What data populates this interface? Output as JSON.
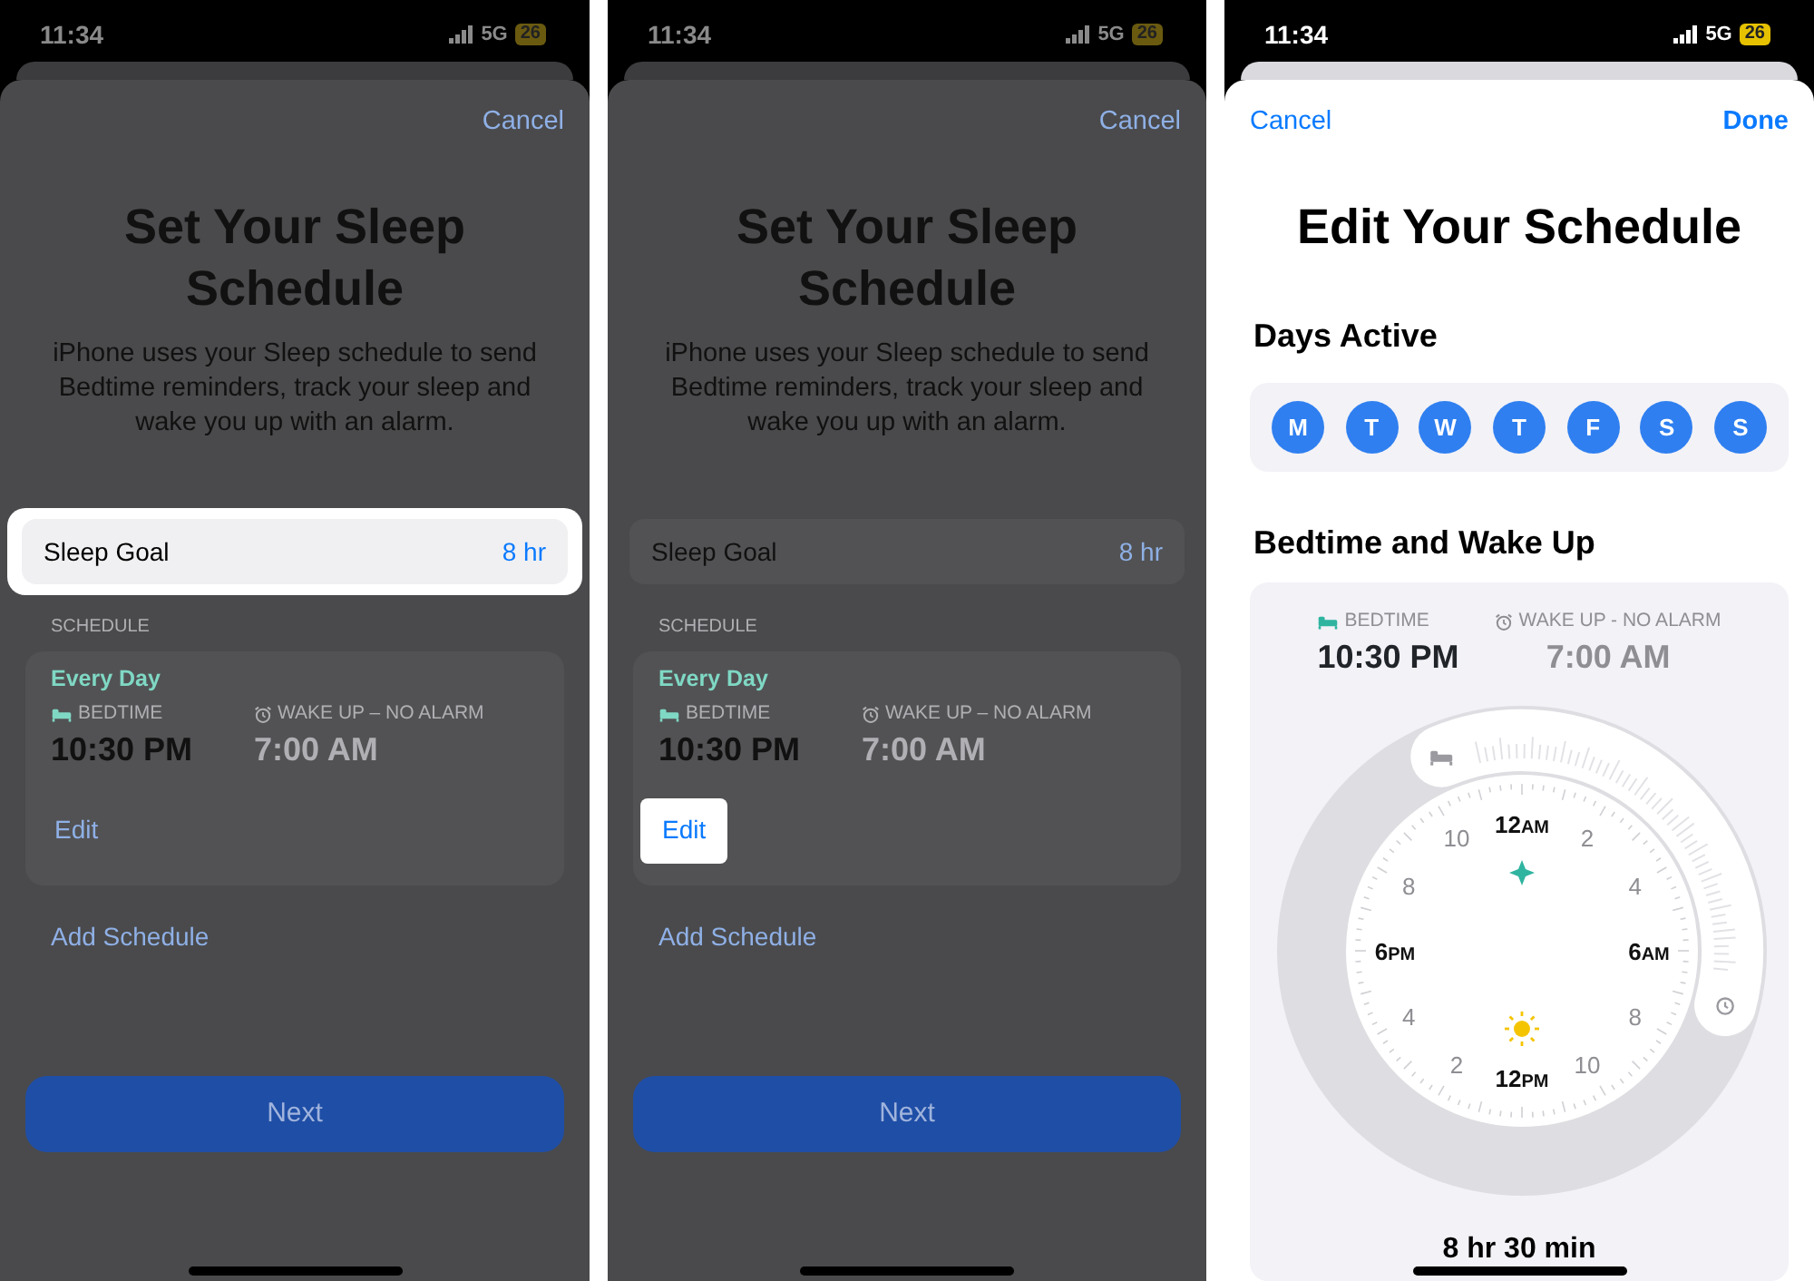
{
  "screens": [
    {
      "kind": "setup",
      "dimmed": true,
      "status": {
        "time": "11:34",
        "network": "5G",
        "battery": "26"
      },
      "cancel": "Cancel",
      "title": "Set Your Sleep Schedule",
      "description": "iPhone uses your Sleep schedule to send Bedtime reminders, track your sleep and wake you up with an alarm.",
      "sleep_goal": {
        "label": "Sleep Goal",
        "value": "8 hr",
        "highlighted": true
      },
      "section_label": "SCHEDULE",
      "schedule": {
        "days": "Every Day",
        "bedtime_label": "BEDTIME",
        "wake_label": "WAKE UP – NO ALARM",
        "bedtime": "10:30 PM",
        "wake": "7:00 AM",
        "edit": {
          "label": "Edit",
          "highlighted": false
        }
      },
      "add": "Add Schedule",
      "next": "Next"
    },
    {
      "kind": "setup",
      "dimmed": true,
      "status": {
        "time": "11:34",
        "network": "5G",
        "battery": "26"
      },
      "cancel": "Cancel",
      "title": "Set Your Sleep Schedule",
      "description": "iPhone uses your Sleep schedule to send Bedtime reminders, track your sleep and wake you up with an alarm.",
      "sleep_goal": {
        "label": "Sleep Goal",
        "value": "8 hr",
        "highlighted": false
      },
      "section_label": "SCHEDULE",
      "schedule": {
        "days": "Every Day",
        "bedtime_label": "BEDTIME",
        "wake_label": "WAKE UP – NO ALARM",
        "bedtime": "10:30 PM",
        "wake": "7:00 AM",
        "edit": {
          "label": "Edit",
          "highlighted": true
        }
      },
      "add": "Add Schedule",
      "next": "Next"
    },
    {
      "kind": "edit",
      "dimmed": false,
      "status": {
        "time": "11:34",
        "network": "5G",
        "battery": "26"
      },
      "cancel": "Cancel",
      "done": "Done",
      "title": "Edit Your Schedule",
      "days_heading": "Days Active",
      "days": [
        {
          "label": "M",
          "selected": true
        },
        {
          "label": "T",
          "selected": true
        },
        {
          "label": "W",
          "selected": true
        },
        {
          "label": "T",
          "selected": true
        },
        {
          "label": "F",
          "selected": true
        },
        {
          "label": "S",
          "selected": true
        },
        {
          "label": "S",
          "selected": true
        }
      ],
      "times_heading": "Bedtime and Wake Up",
      "bedtime_label": "BEDTIME",
      "wake_label": "WAKE UP - NO ALARM",
      "bedtime": "10:30 PM",
      "wake": "7:00 AM",
      "dial_labels_right": [
        {
          "hour": "12",
          "suffix": "AM"
        },
        {
          "hour": "2"
        },
        {
          "hour": "4"
        },
        {
          "hour": "6",
          "suffix": "AM"
        },
        {
          "hour": "8"
        },
        {
          "hour": "10"
        },
        {
          "hour": "12",
          "suffix": "PM"
        }
      ],
      "dial_labels_left": [
        {
          "hour": "10"
        },
        {
          "hour": "8"
        },
        {
          "hour": "6",
          "suffix": "PM"
        },
        {
          "hour": "4"
        },
        {
          "hour": "2"
        }
      ],
      "duration": "8 hr 30 min"
    }
  ]
}
